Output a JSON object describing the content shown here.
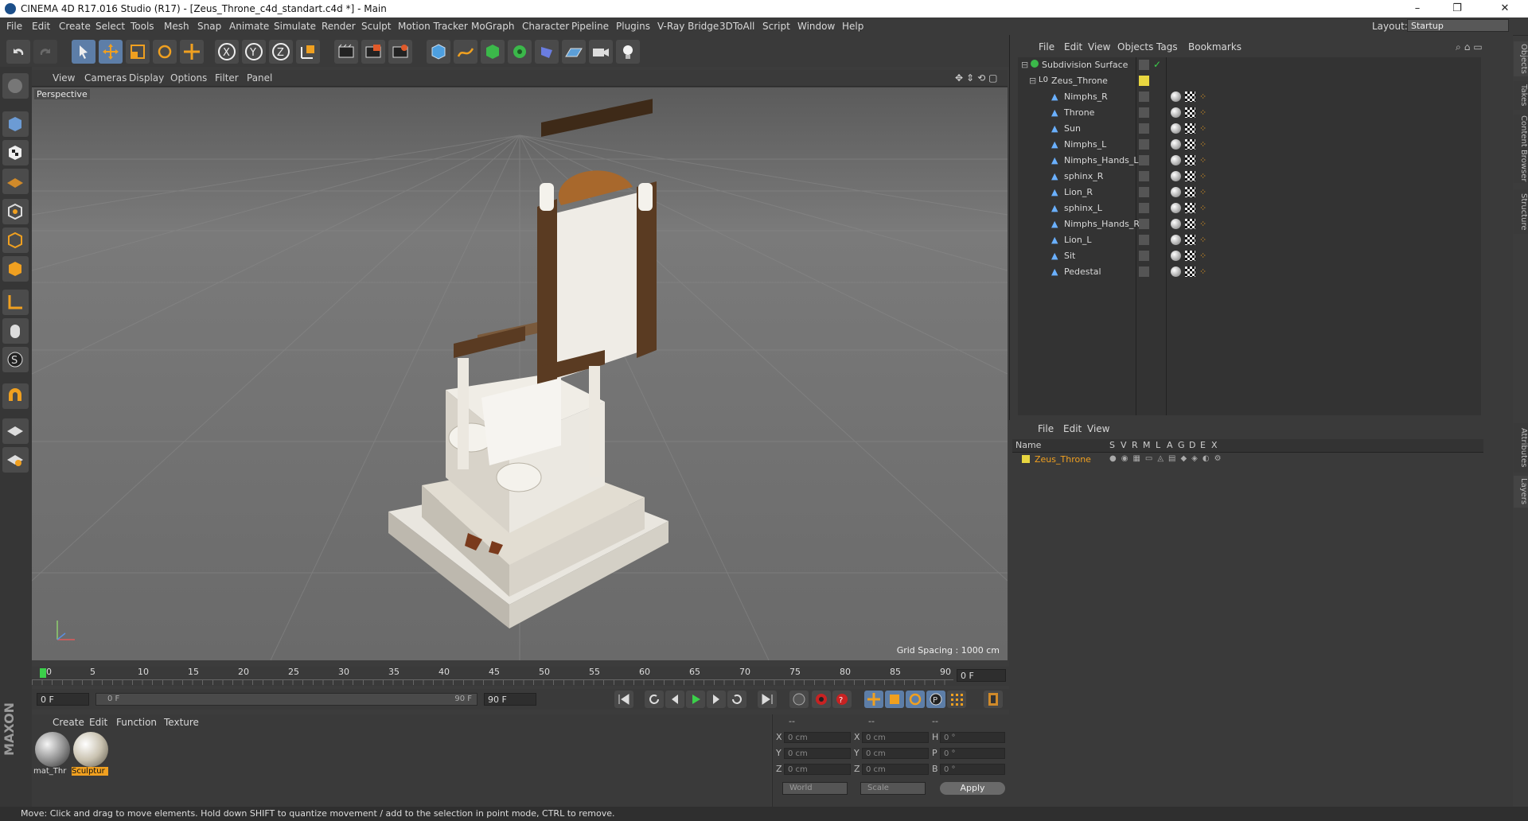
{
  "window": {
    "title": "CINEMA 4D R17.016 Studio (R17) - [Zeus_Throne_c4d_standart.c4d *] - Main",
    "controls": [
      "–",
      "❐",
      "✕"
    ]
  },
  "menu": {
    "items": [
      "File",
      "Edit",
      "Create",
      "Select",
      "Tools",
      "Mesh",
      "Snap",
      "Animate",
      "Simulate",
      "Render",
      "Sculpt",
      "Motion Tracker",
      "MoGraph",
      "Character",
      "Pipeline",
      "Plugins",
      "V-Ray Bridge",
      "3DToAll",
      "Script",
      "Window",
      "Help"
    ],
    "layout_label": "Layout:",
    "layout_value": "Startup"
  },
  "viewport": {
    "menu": [
      "View",
      "Cameras",
      "Display",
      "Options",
      "Filter",
      "Panel"
    ],
    "label": "Perspective",
    "grid_spacing": "Grid Spacing : 1000 cm"
  },
  "timeline": {
    "ticks": [
      "0",
      "5",
      "10",
      "15",
      "20",
      "25",
      "30",
      "35",
      "40",
      "45",
      "50",
      "55",
      "60",
      "65",
      "70",
      "75",
      "80",
      "85",
      "90"
    ],
    "current_frame": "0 F",
    "start_frame": "0 F",
    "range_start": "0 F",
    "range_end": "90 F",
    "end_frame": "90 F"
  },
  "materials": {
    "menu": [
      "Create",
      "Edit",
      "Function",
      "Texture"
    ],
    "items": [
      "mat_Thr",
      "Sculptur"
    ]
  },
  "coords": {
    "header": [
      "--",
      "--",
      "--"
    ],
    "rows": [
      {
        "a": "X",
        "av": "0 cm",
        "b": "X",
        "bv": "0 cm",
        "c": "H",
        "cv": "0 °"
      },
      {
        "a": "Y",
        "av": "0 cm",
        "b": "Y",
        "bv": "0 cm",
        "c": "P",
        "cv": "0 °"
      },
      {
        "a": "Z",
        "av": "0 cm",
        "b": "Z",
        "bv": "0 cm",
        "c": "B",
        "cv": "0 °"
      }
    ],
    "space": "World",
    "mode": "Scale",
    "apply": "Apply"
  },
  "objects": {
    "menu": [
      "File",
      "Edit",
      "View",
      "Objects",
      "Tags",
      "Bookmarks"
    ],
    "tree": [
      "Subdivision Surface",
      "Zeus_Throne",
      "Nimphs_R",
      "Throne",
      "Sun",
      "Nimphs_L",
      "Nimphs_Hands_L",
      "sphinx_R",
      "Lion_R",
      "sphinx_L",
      "Nimphs_Hands_R",
      "Lion_L",
      "Sit",
      "Pedestal"
    ]
  },
  "layers": {
    "menu": [
      "File",
      "Edit",
      "View"
    ],
    "columns": [
      "Name",
      "S",
      "V",
      "R",
      "M",
      "L",
      "A",
      "G",
      "D",
      "E",
      "X"
    ],
    "rows": [
      "Zeus_Throne"
    ]
  },
  "side_tabs": [
    "Objects",
    "Takes",
    "Content Browser",
    "Structure",
    "Attributes",
    "Layers"
  ],
  "status": "Move: Click and drag to move elements. Hold down SHIFT to quantize movement / add to the selection in point mode, CTRL to remove.",
  "colors": {
    "accent": "#f0a020",
    "highlight": "#e8c440",
    "blue": "#4d9fe0"
  }
}
